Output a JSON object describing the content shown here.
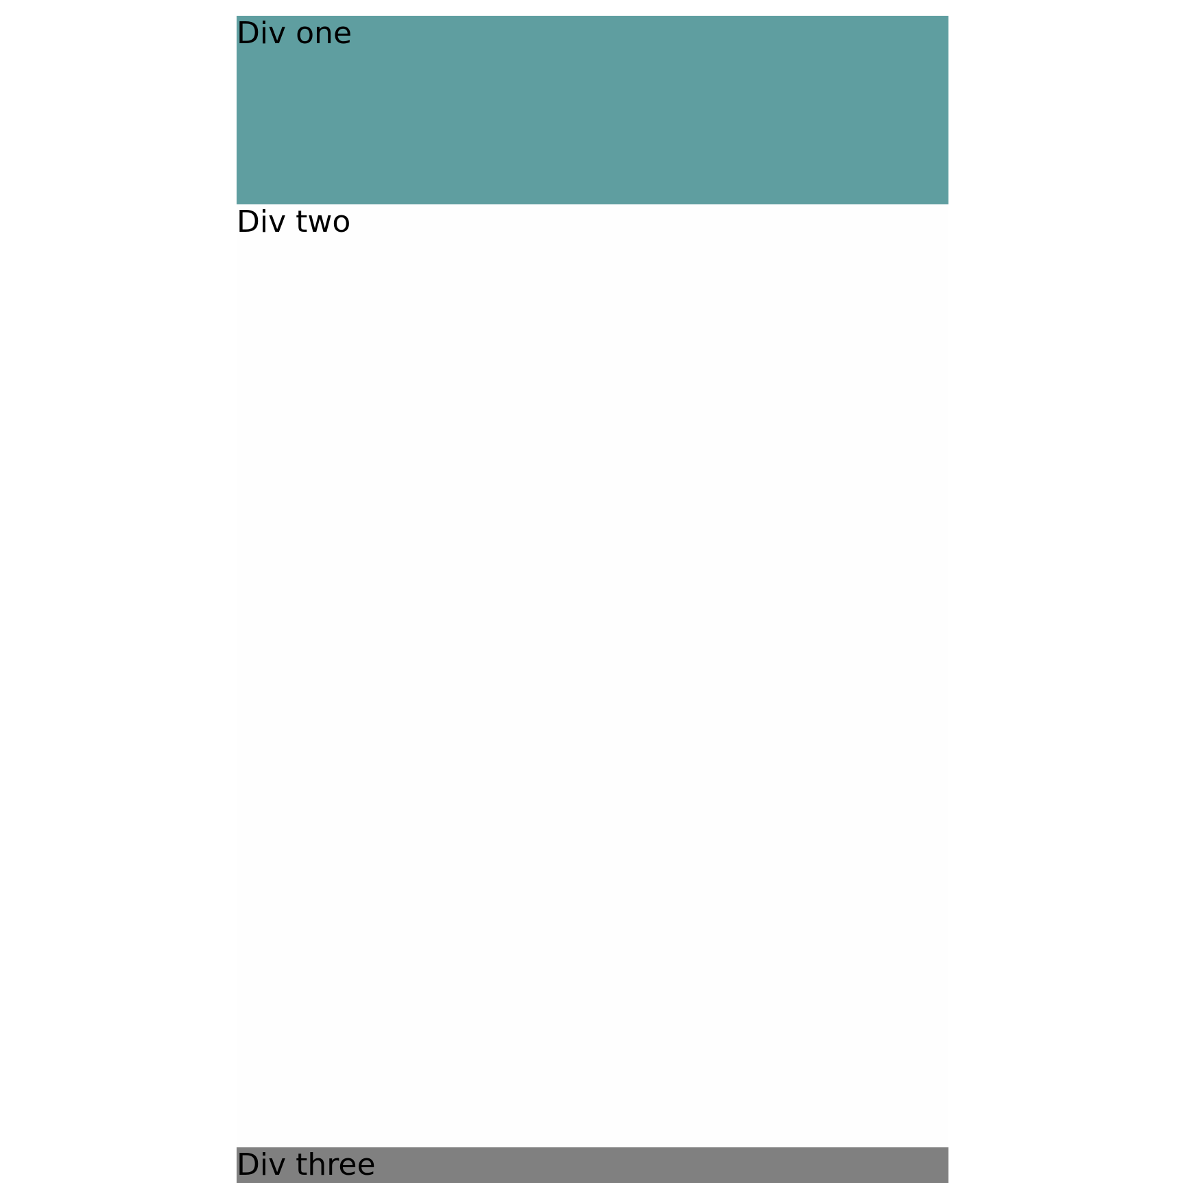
{
  "blocks": [
    {
      "label": "Div one",
      "background": "#5f9ea0"
    },
    {
      "label": "Div two",
      "background": "#fefefe"
    },
    {
      "label": "Div three",
      "background": "#808080"
    }
  ]
}
